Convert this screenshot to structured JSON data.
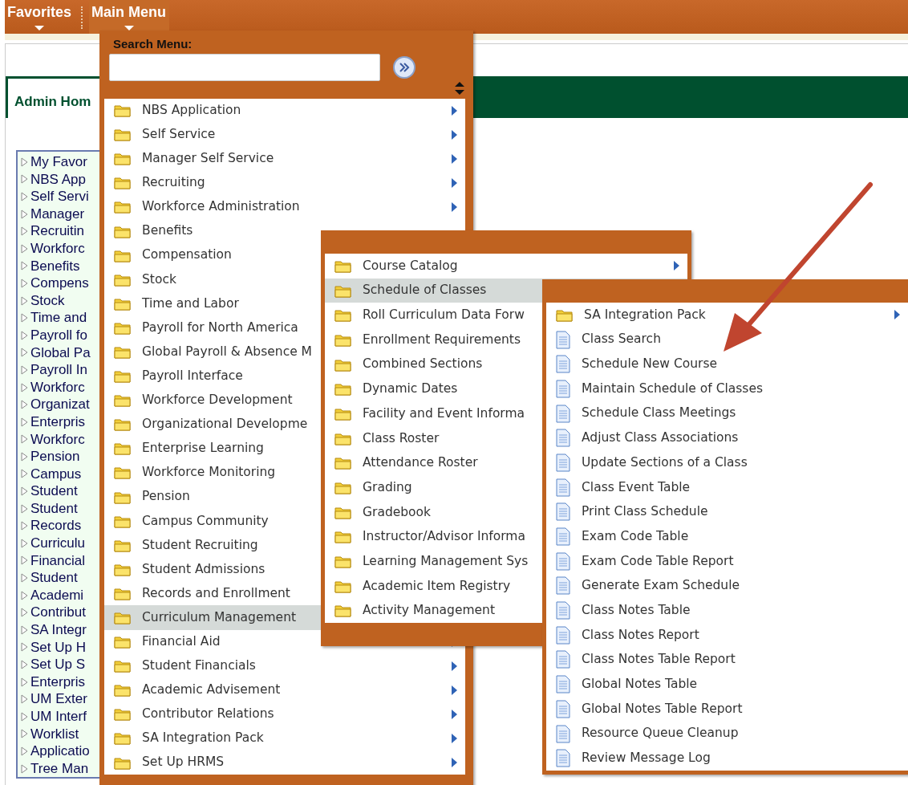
{
  "top_menu": [
    {
      "label": "Favorites",
      "selected": false
    },
    {
      "label": "Main Menu",
      "selected": true
    }
  ],
  "page_tab": {
    "label": "Admin Hom"
  },
  "tree": {
    "items": [
      "My Favor",
      "NBS App",
      "Self Servi",
      "Manager",
      "Recruitin",
      "Workforc",
      "Benefits",
      "Compens",
      "Stock",
      "Time and",
      "Payroll fo",
      "Global Pa",
      "Payroll In",
      "Workforc",
      "Organizat",
      "Enterpris",
      "Workforc",
      "Pension",
      "Campus",
      "Student",
      "Student",
      "Records",
      "Curriculu",
      "Financial",
      "Student",
      "Academi",
      "Contribut",
      "SA Integr",
      "Set Up H",
      "Set Up S",
      "Enterpris",
      "UM Exter",
      "UM Interf",
      "Worklist",
      "Applicatio",
      "Tree Man"
    ]
  },
  "main_menu": {
    "search_label": "Search Menu:",
    "items": [
      {
        "label": "NBS Application",
        "selected": false,
        "submenu": true
      },
      {
        "label": "Self Service",
        "selected": false,
        "submenu": true
      },
      {
        "label": "Manager Self Service",
        "selected": false,
        "submenu": true
      },
      {
        "label": "Recruiting",
        "selected": false,
        "submenu": true
      },
      {
        "label": "Workforce Administration",
        "selected": false,
        "submenu": true
      },
      {
        "label": "Benefits",
        "selected": false,
        "submenu": false
      },
      {
        "label": "Compensation",
        "selected": false,
        "submenu": false
      },
      {
        "label": "Stock",
        "selected": false,
        "submenu": false
      },
      {
        "label": "Time and Labor",
        "selected": false,
        "submenu": false
      },
      {
        "label": "Payroll for North America",
        "selected": false,
        "submenu": false
      },
      {
        "label": "Global Payroll & Absence M",
        "selected": false,
        "submenu": false
      },
      {
        "label": "Payroll Interface",
        "selected": false,
        "submenu": false
      },
      {
        "label": "Workforce Development",
        "selected": false,
        "submenu": false
      },
      {
        "label": "Organizational Developme",
        "selected": false,
        "submenu": false
      },
      {
        "label": "Enterprise Learning",
        "selected": false,
        "submenu": false
      },
      {
        "label": "Workforce Monitoring",
        "selected": false,
        "submenu": false
      },
      {
        "label": "Pension",
        "selected": false,
        "submenu": false
      },
      {
        "label": "Campus Community",
        "selected": false,
        "submenu": false
      },
      {
        "label": "Student Recruiting",
        "selected": false,
        "submenu": false
      },
      {
        "label": "Student Admissions",
        "selected": false,
        "submenu": false
      },
      {
        "label": "Records and Enrollment",
        "selected": false,
        "submenu": false
      },
      {
        "label": "Curriculum Management",
        "selected": true,
        "submenu": false
      },
      {
        "label": "Financial Aid",
        "selected": false,
        "submenu": true
      },
      {
        "label": "Student Financials",
        "selected": false,
        "submenu": true
      },
      {
        "label": "Academic Advisement",
        "selected": false,
        "submenu": true
      },
      {
        "label": "Contributor Relations",
        "selected": false,
        "submenu": true
      },
      {
        "label": "SA Integration Pack",
        "selected": false,
        "submenu": true
      },
      {
        "label": "Set Up HRMS",
        "selected": false,
        "submenu": true
      }
    ]
  },
  "submenu_1": {
    "items": [
      {
        "label": "Course Catalog",
        "selected": false,
        "submenu": true
      },
      {
        "label": "Schedule of Classes",
        "selected": true,
        "submenu": false
      },
      {
        "label": "Roll Curriculum Data Forw",
        "selected": false,
        "submenu": false
      },
      {
        "label": "Enrollment Requirements",
        "selected": false,
        "submenu": false
      },
      {
        "label": "Combined Sections",
        "selected": false,
        "submenu": false
      },
      {
        "label": "Dynamic Dates",
        "selected": false,
        "submenu": false
      },
      {
        "label": "Facility and Event Informa",
        "selected": false,
        "submenu": false
      },
      {
        "label": "Class Roster",
        "selected": false,
        "submenu": false
      },
      {
        "label": "Attendance Roster",
        "selected": false,
        "submenu": false
      },
      {
        "label": "Grading",
        "selected": false,
        "submenu": false
      },
      {
        "label": "Gradebook",
        "selected": false,
        "submenu": false
      },
      {
        "label": "Instructor/Advisor Informa",
        "selected": false,
        "submenu": false
      },
      {
        "label": "Learning Management Sys",
        "selected": false,
        "submenu": false
      },
      {
        "label": "Academic Item Registry",
        "selected": false,
        "submenu": false
      },
      {
        "label": "Activity Management",
        "selected": false,
        "submenu": false
      }
    ]
  },
  "submenu_2": {
    "items": [
      {
        "label": "SA Integration Pack",
        "kind": "folder",
        "submenu": true
      },
      {
        "label": "Class Search",
        "kind": "page",
        "submenu": false
      },
      {
        "label": "Schedule New Course",
        "kind": "page",
        "submenu": false
      },
      {
        "label": "Maintain Schedule of Classes",
        "kind": "page",
        "submenu": false
      },
      {
        "label": "Schedule Class Meetings",
        "kind": "page",
        "submenu": false
      },
      {
        "label": "Adjust Class Associations",
        "kind": "page",
        "submenu": false
      },
      {
        "label": "Update Sections of a Class",
        "kind": "page",
        "submenu": false
      },
      {
        "label": "Class Event Table",
        "kind": "page",
        "submenu": false
      },
      {
        "label": "Print Class Schedule",
        "kind": "page",
        "submenu": false
      },
      {
        "label": "Exam Code Table",
        "kind": "page",
        "submenu": false
      },
      {
        "label": "Exam Code Table Report",
        "kind": "page",
        "submenu": false
      },
      {
        "label": "Generate Exam Schedule",
        "kind": "page",
        "submenu": false
      },
      {
        "label": "Class Notes Table",
        "kind": "page",
        "submenu": false
      },
      {
        "label": "Class Notes Report",
        "kind": "page",
        "submenu": false
      },
      {
        "label": "Class Notes Table Report",
        "kind": "page",
        "submenu": false
      },
      {
        "label": "Global Notes Table",
        "kind": "page",
        "submenu": false
      },
      {
        "label": "Global Notes Table Report",
        "kind": "page",
        "submenu": false
      },
      {
        "label": "Resource Queue Cleanup",
        "kind": "page",
        "submenu": false
      },
      {
        "label": "Review Message Log",
        "kind": "page",
        "submenu": false
      }
    ]
  }
}
